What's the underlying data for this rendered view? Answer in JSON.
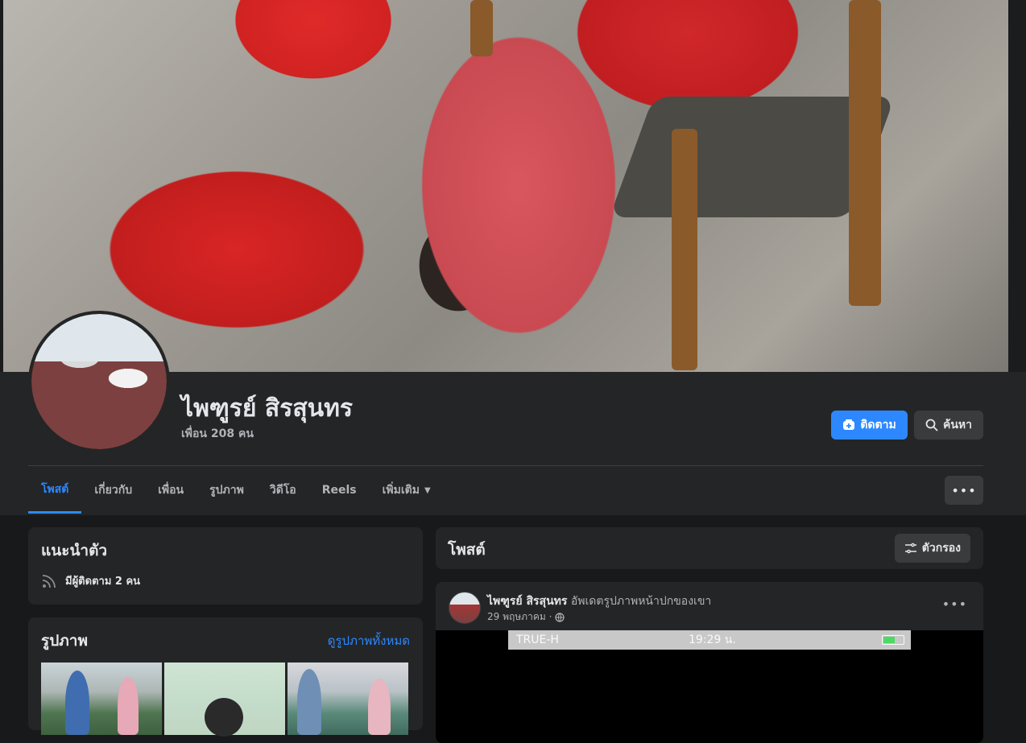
{
  "profile": {
    "name": "ไพฑูรย์ สิรสุนทร",
    "friends": "เพื่อน 208 คน"
  },
  "actions": {
    "follow_label": "ติดตาม",
    "search_label": "ค้นหา"
  },
  "tabs": [
    {
      "label": "โพสต์",
      "active": true
    },
    {
      "label": "เกี่ยวกับ"
    },
    {
      "label": "เพื่อน"
    },
    {
      "label": "รูปภาพ"
    },
    {
      "label": "วิดีโอ"
    },
    {
      "label": "Reels"
    },
    {
      "label": "เพิ่มเติม"
    }
  ],
  "intro": {
    "title": "แนะนำตัว",
    "followers": "มีผู้ติดตาม 2 คน"
  },
  "photos": {
    "title": "รูปภาพ",
    "see_all": "ดูรูปภาพทั้งหมด"
  },
  "posts": {
    "title": "โพสต์",
    "filter_label": "ตัวกรอง"
  },
  "post": {
    "author": "ไพฑูรย์ สิรสุนทร",
    "action": "อัพเดตรูปภาพหน้าปกของเขา",
    "date": "29 พฤษภาคม ·",
    "statusbar": {
      "carrier": "TRUE-H",
      "time": "19:29 น.",
      "battery_level": 0.6
    }
  },
  "colors": {
    "accent": "#2d88ff",
    "background": "#18191a",
    "card": "#242526"
  }
}
